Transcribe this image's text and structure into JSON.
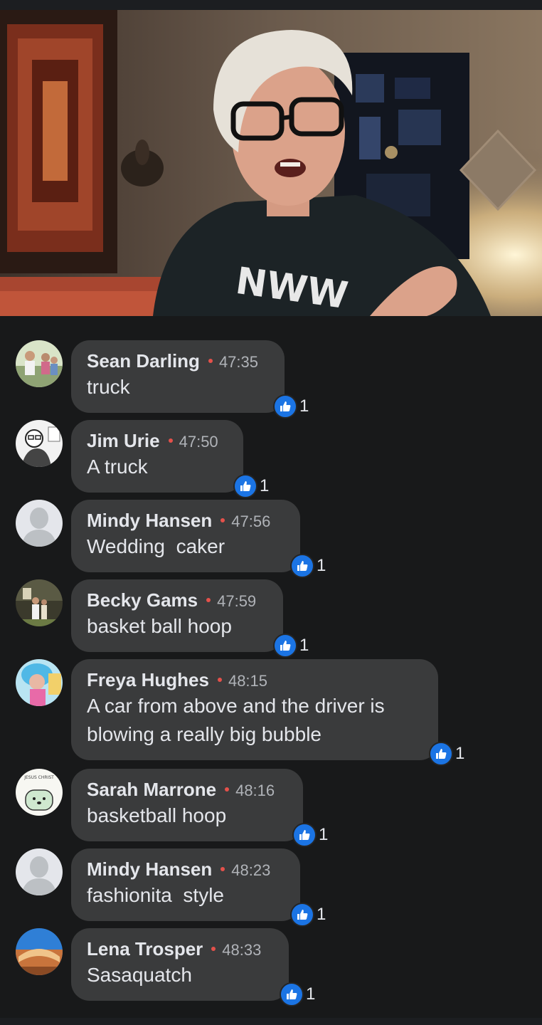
{
  "comments": [
    {
      "author": "Sean Darling",
      "time": "47:35",
      "text": "truck",
      "reactions": "1",
      "avatar": "photo-group"
    },
    {
      "author": "Jim Urie",
      "time": "47:50",
      "text": "A truck",
      "reactions": "1",
      "avatar": "cartoon-sketch"
    },
    {
      "author": "Mindy Hansen",
      "time": "47:56",
      "text": "Wedding  caker",
      "reactions": "1",
      "avatar": "default-silhouette"
    },
    {
      "author": "Becky Gams",
      "time": "47:59",
      "text": "basket ball hoop",
      "reactions": "1",
      "avatar": "photo-outdoor"
    },
    {
      "author": "Freya Hughes",
      "time": "48:15",
      "text": "A car from above and the driver is blowing a really big bubble",
      "reactions": "1",
      "avatar": "photo-blue-hair"
    },
    {
      "author": "Sarah Marrone",
      "time": "48:16",
      "text": "basketball hoop",
      "reactions": "1",
      "avatar": "drawing-bear"
    },
    {
      "author": "Mindy Hansen",
      "time": "48:23",
      "text": "fashionita  style",
      "reactions": "1",
      "avatar": "default-silhouette"
    },
    {
      "author": "Lena Trosper",
      "time": "48:33",
      "text": "Sasaquatch",
      "reactions": "1",
      "avatar": "photo-arch"
    }
  ],
  "video": {
    "shirt_text": "NWW"
  },
  "avatar_art": {
    "sarah": "JESUS CHRIST"
  },
  "colors": {
    "background": "#18191a",
    "bubble": "#3a3b3c",
    "like_blue": "#1b74e4",
    "live_dot": "#e4514b"
  }
}
